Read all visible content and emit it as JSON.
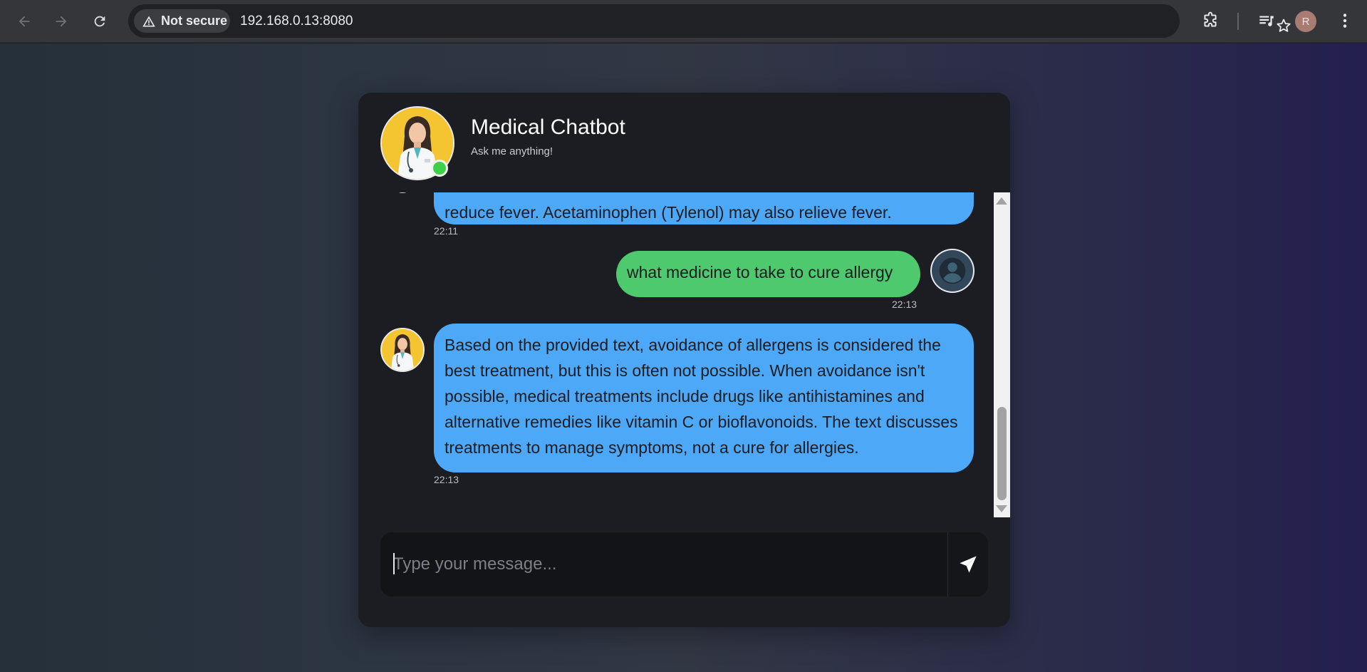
{
  "browser": {
    "security_label": "Not secure",
    "url": "192.168.0.13:8080",
    "profile_initial": "R"
  },
  "chat": {
    "title": "Medical Chatbot",
    "subtitle": "Ask me anything!",
    "messages": [
      {
        "sender": "bot",
        "text": "reduce fever. Acetaminophen (Tylenol) may also relieve fever.",
        "time": "22:11"
      },
      {
        "sender": "user",
        "text": "what medicine to take to cure allergy",
        "time": "22:13"
      },
      {
        "sender": "bot",
        "text": "Based on the provided text, avoidance of allergens is considered the best treatment, but this is often not possible. When avoidance isn't possible, medical treatments include drugs like antihistamines and alternative remedies like vitamin C or bioflavonoids. The text discusses treatments to manage symptoms, not a cure for allergies.",
        "time": "22:13"
      }
    ],
    "input": {
      "value": "",
      "placeholder": "Type your message..."
    },
    "status": "online"
  },
  "colors": {
    "bot_bubble": "#4da8f8",
    "user_bubble": "#4fc96e",
    "card_bg": "#1b1d22",
    "online_dot": "#3fd04a"
  },
  "icons": {
    "back": "arrow-left-icon",
    "forward": "arrow-right-icon",
    "reload": "reload-icon",
    "security": "warning-triangle-icon",
    "bookmark": "star-icon",
    "extensions": "puzzle-icon",
    "media": "media-control-icon",
    "menu": "kebab-menu-icon",
    "send": "paper-plane-icon",
    "user": "user-icon"
  }
}
